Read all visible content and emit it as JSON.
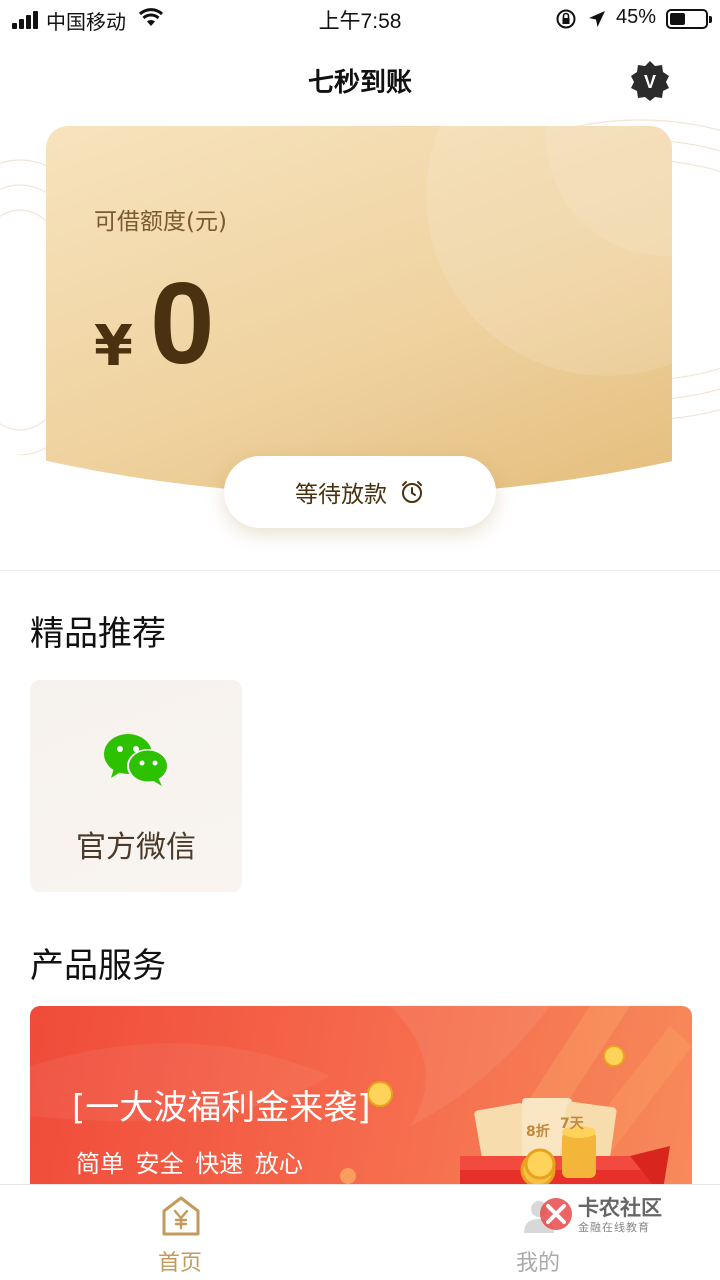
{
  "status_bar": {
    "carrier": "中国移动",
    "time": "上午7:58",
    "battery": "45%",
    "battery_level": 0.45
  },
  "nav": {
    "title": "七秒到账",
    "vip_icon": "vip-badge-icon",
    "vip_letter": "V"
  },
  "credit": {
    "label": "可借额度(元)",
    "currency_symbol": "¥",
    "amount": "0",
    "button_label": "等待放款",
    "button_icon": "alarm-clock-icon"
  },
  "recommend": {
    "title": "精品推荐",
    "items": [
      {
        "label": "官方微信",
        "icon": "wechat-icon"
      }
    ]
  },
  "services": {
    "title": "产品服务",
    "banner": {
      "title": "[一大波福利金来袭]",
      "subtitle": "简单 安全 快速 放心",
      "ticket_labels": [
        "8折",
        "7天"
      ]
    }
  },
  "tab_bar": {
    "items": [
      {
        "label": "首页",
        "icon": "home-yen-icon",
        "active": true
      },
      {
        "label": "我的",
        "icon": "user-icon",
        "active": false
      }
    ]
  },
  "watermark": {
    "name": "卡农社区",
    "sub": "金融在线教育"
  },
  "colors": {
    "accent_gold": "#c49a5c",
    "card_dark_text": "#4a3210",
    "banner_red": "#f04b3a",
    "wechat_green": "#2dc100"
  }
}
